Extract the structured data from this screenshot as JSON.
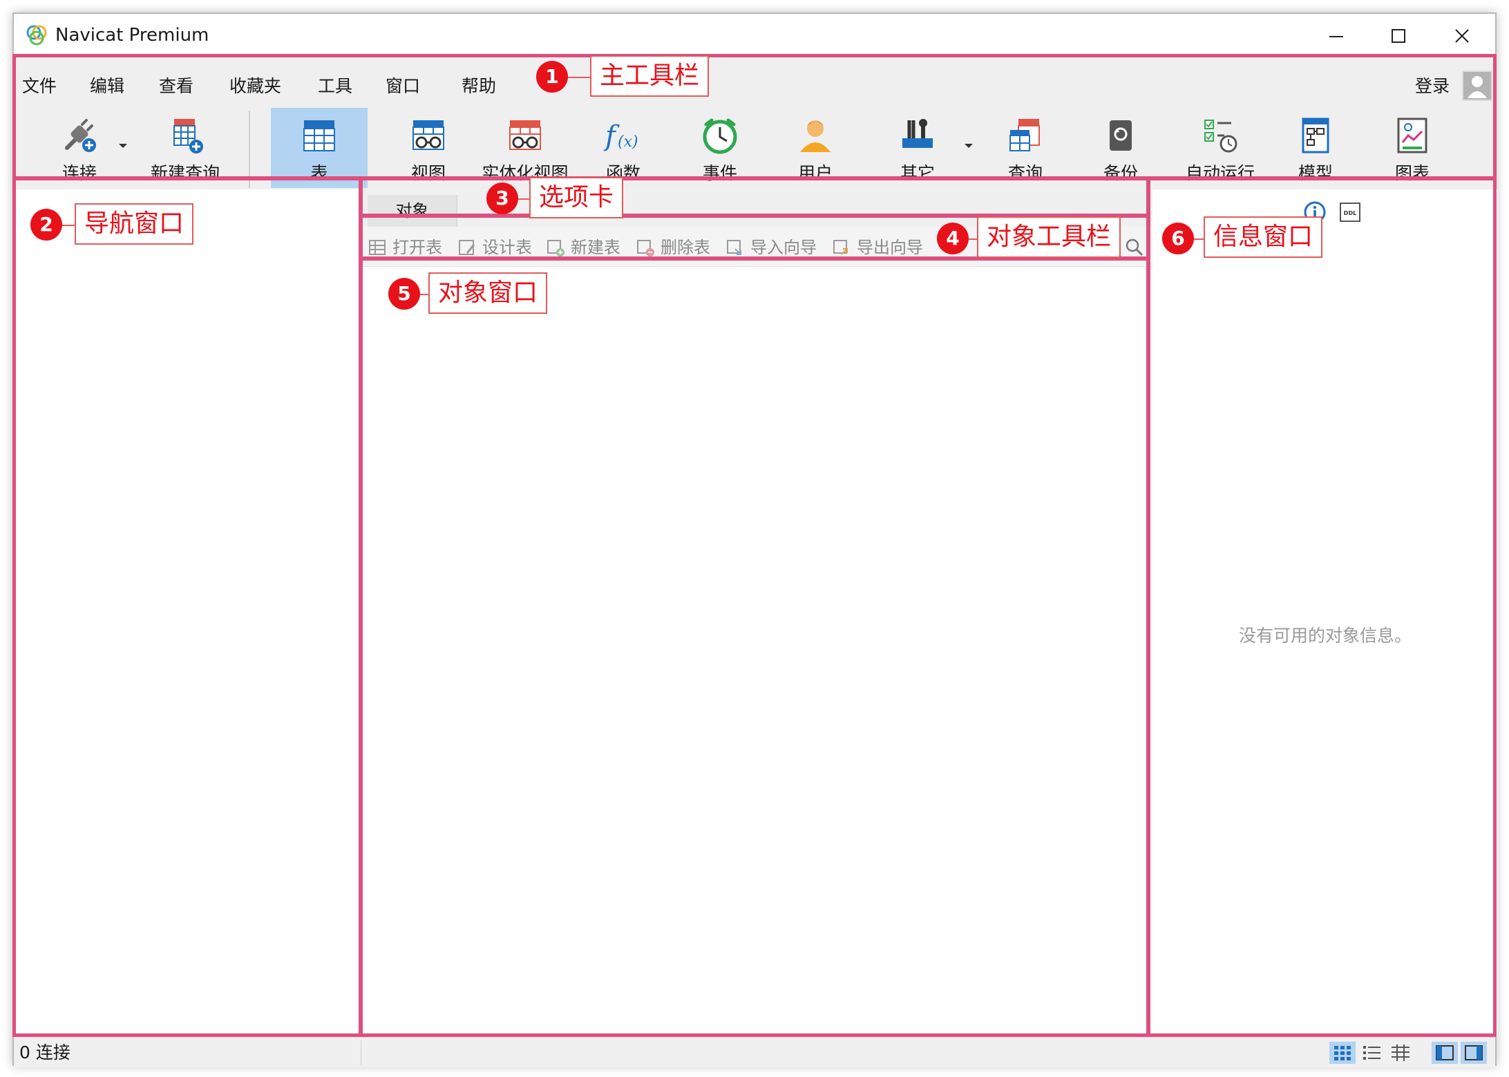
{
  "window": {
    "title": "Navicat Premium"
  },
  "menu": [
    "文件",
    "编辑",
    "查看",
    "收藏夹",
    "工具",
    "窗口",
    "帮助"
  ],
  "login_label": "登录",
  "toolbar": {
    "connect": "连接",
    "new_query": "新建查询",
    "table": "表",
    "view": "视图",
    "materialized_view": "实体化视图",
    "function": "函数",
    "event": "事件",
    "user": "用户",
    "other": "其它",
    "query": "查询",
    "backup": "备份",
    "automation": "自动运行",
    "model": "模型",
    "chart": "图表"
  },
  "tabs": [
    "对象"
  ],
  "object_toolbar": [
    "打开表",
    "设计表",
    "新建表",
    "删除表",
    "导入向导",
    "导出向导"
  ],
  "info_panel": {
    "empty_message": "没有可用的对象信息。"
  },
  "status_bar": {
    "connections": "0 连接"
  },
  "annotations": [
    {
      "number": "1",
      "label": "主工具栏"
    },
    {
      "number": "2",
      "label": "导航窗口"
    },
    {
      "number": "3",
      "label": "选项卡"
    },
    {
      "number": "4",
      "label": "对象工具栏"
    },
    {
      "number": "5",
      "label": "对象窗口"
    },
    {
      "number": "6",
      "label": "信息窗口"
    }
  ],
  "colors": {
    "highlight": "#de4f7e",
    "badge": "#e8111a",
    "active_tool": "#b2d3f2"
  }
}
